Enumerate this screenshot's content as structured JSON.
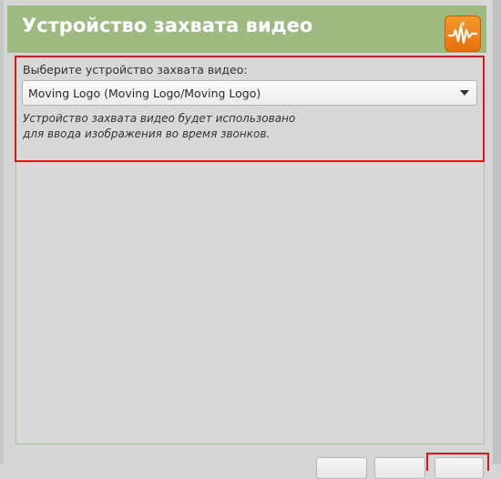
{
  "header": {
    "title": "Устройство захвата видео",
    "logo_icon": "waveform-app-icon",
    "background_color": "#9dbb80",
    "logo_color": "#f08a1f"
  },
  "capture": {
    "field_label": "Выберите устройство захвата видео:",
    "selected_device": "Moving Logo (Moving Logo/Moving Logo)",
    "help_text": "Устройство захвата видео будет использовано для ввода изображения во время звонков."
  },
  "highlight_color": "#e0151b"
}
